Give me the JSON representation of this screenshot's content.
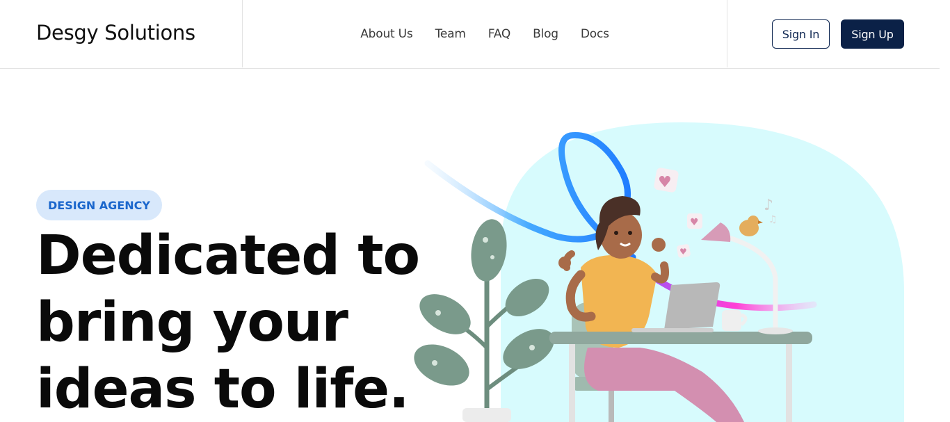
{
  "brand": {
    "name": "Desgy Solutions"
  },
  "nav": {
    "items": [
      {
        "label": "About Us"
      },
      {
        "label": "Team"
      },
      {
        "label": "FAQ"
      },
      {
        "label": "Blog"
      },
      {
        "label": "Docs"
      }
    ]
  },
  "auth": {
    "sign_in_label": "Sign In",
    "sign_up_label": "Sign Up"
  },
  "hero": {
    "badge": "DESIGN AGENCY",
    "headline_lines": [
      "Dedicated to",
      "bring your",
      "ideas to life."
    ]
  },
  "colors": {
    "primary_dark": "#0b2147",
    "badge_bg": "#d8e8fb",
    "badge_text": "#1a66cc",
    "hero_shape": "#d7fbfd"
  },
  "illustration": {
    "subject": "woman-at-desk-with-laptop",
    "icons": [
      "plant-icon",
      "heart-icon",
      "desk-lamp-icon",
      "bird-icon",
      "music-note-icon",
      "mug-icon"
    ]
  }
}
